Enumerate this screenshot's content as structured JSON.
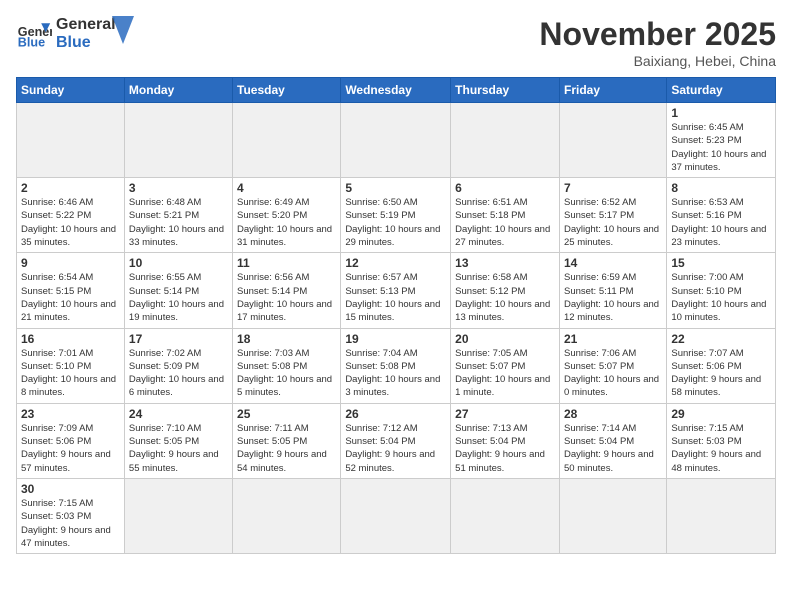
{
  "header": {
    "logo_general": "General",
    "logo_blue": "Blue",
    "month_title": "November 2025",
    "location": "Baixiang, Hebei, China"
  },
  "weekdays": [
    "Sunday",
    "Monday",
    "Tuesday",
    "Wednesday",
    "Thursday",
    "Friday",
    "Saturday"
  ],
  "weeks": [
    [
      {
        "day": "",
        "info": ""
      },
      {
        "day": "",
        "info": ""
      },
      {
        "day": "",
        "info": ""
      },
      {
        "day": "",
        "info": ""
      },
      {
        "day": "",
        "info": ""
      },
      {
        "day": "",
        "info": ""
      },
      {
        "day": "1",
        "info": "Sunrise: 6:45 AM\nSunset: 5:23 PM\nDaylight: 10 hours\nand 37 minutes."
      }
    ],
    [
      {
        "day": "2",
        "info": "Sunrise: 6:46 AM\nSunset: 5:22 PM\nDaylight: 10 hours\nand 35 minutes."
      },
      {
        "day": "3",
        "info": "Sunrise: 6:48 AM\nSunset: 5:21 PM\nDaylight: 10 hours\nand 33 minutes."
      },
      {
        "day": "4",
        "info": "Sunrise: 6:49 AM\nSunset: 5:20 PM\nDaylight: 10 hours\nand 31 minutes."
      },
      {
        "day": "5",
        "info": "Sunrise: 6:50 AM\nSunset: 5:19 PM\nDaylight: 10 hours\nand 29 minutes."
      },
      {
        "day": "6",
        "info": "Sunrise: 6:51 AM\nSunset: 5:18 PM\nDaylight: 10 hours\nand 27 minutes."
      },
      {
        "day": "7",
        "info": "Sunrise: 6:52 AM\nSunset: 5:17 PM\nDaylight: 10 hours\nand 25 minutes."
      },
      {
        "day": "8",
        "info": "Sunrise: 6:53 AM\nSunset: 5:16 PM\nDaylight: 10 hours\nand 23 minutes."
      }
    ],
    [
      {
        "day": "9",
        "info": "Sunrise: 6:54 AM\nSunset: 5:15 PM\nDaylight: 10 hours\nand 21 minutes."
      },
      {
        "day": "10",
        "info": "Sunrise: 6:55 AM\nSunset: 5:14 PM\nDaylight: 10 hours\nand 19 minutes."
      },
      {
        "day": "11",
        "info": "Sunrise: 6:56 AM\nSunset: 5:14 PM\nDaylight: 10 hours\nand 17 minutes."
      },
      {
        "day": "12",
        "info": "Sunrise: 6:57 AM\nSunset: 5:13 PM\nDaylight: 10 hours\nand 15 minutes."
      },
      {
        "day": "13",
        "info": "Sunrise: 6:58 AM\nSunset: 5:12 PM\nDaylight: 10 hours\nand 13 minutes."
      },
      {
        "day": "14",
        "info": "Sunrise: 6:59 AM\nSunset: 5:11 PM\nDaylight: 10 hours\nand 12 minutes."
      },
      {
        "day": "15",
        "info": "Sunrise: 7:00 AM\nSunset: 5:10 PM\nDaylight: 10 hours\nand 10 minutes."
      }
    ],
    [
      {
        "day": "16",
        "info": "Sunrise: 7:01 AM\nSunset: 5:10 PM\nDaylight: 10 hours\nand 8 minutes."
      },
      {
        "day": "17",
        "info": "Sunrise: 7:02 AM\nSunset: 5:09 PM\nDaylight: 10 hours\nand 6 minutes."
      },
      {
        "day": "18",
        "info": "Sunrise: 7:03 AM\nSunset: 5:08 PM\nDaylight: 10 hours\nand 5 minutes."
      },
      {
        "day": "19",
        "info": "Sunrise: 7:04 AM\nSunset: 5:08 PM\nDaylight: 10 hours\nand 3 minutes."
      },
      {
        "day": "20",
        "info": "Sunrise: 7:05 AM\nSunset: 5:07 PM\nDaylight: 10 hours\nand 1 minute."
      },
      {
        "day": "21",
        "info": "Sunrise: 7:06 AM\nSunset: 5:07 PM\nDaylight: 10 hours\nand 0 minutes."
      },
      {
        "day": "22",
        "info": "Sunrise: 7:07 AM\nSunset: 5:06 PM\nDaylight: 9 hours\nand 58 minutes."
      }
    ],
    [
      {
        "day": "23",
        "info": "Sunrise: 7:09 AM\nSunset: 5:06 PM\nDaylight: 9 hours\nand 57 minutes."
      },
      {
        "day": "24",
        "info": "Sunrise: 7:10 AM\nSunset: 5:05 PM\nDaylight: 9 hours\nand 55 minutes."
      },
      {
        "day": "25",
        "info": "Sunrise: 7:11 AM\nSunset: 5:05 PM\nDaylight: 9 hours\nand 54 minutes."
      },
      {
        "day": "26",
        "info": "Sunrise: 7:12 AM\nSunset: 5:04 PM\nDaylight: 9 hours\nand 52 minutes."
      },
      {
        "day": "27",
        "info": "Sunrise: 7:13 AM\nSunset: 5:04 PM\nDaylight: 9 hours\nand 51 minutes."
      },
      {
        "day": "28",
        "info": "Sunrise: 7:14 AM\nSunset: 5:04 PM\nDaylight: 9 hours\nand 50 minutes."
      },
      {
        "day": "29",
        "info": "Sunrise: 7:15 AM\nSunset: 5:03 PM\nDaylight: 9 hours\nand 48 minutes."
      }
    ],
    [
      {
        "day": "30",
        "info": "Sunrise: 7:15 AM\nSunset: 5:03 PM\nDaylight: 9 hours\nand 47 minutes."
      },
      {
        "day": "",
        "info": ""
      },
      {
        "day": "",
        "info": ""
      },
      {
        "day": "",
        "info": ""
      },
      {
        "day": "",
        "info": ""
      },
      {
        "day": "",
        "info": ""
      },
      {
        "day": "",
        "info": ""
      }
    ]
  ]
}
